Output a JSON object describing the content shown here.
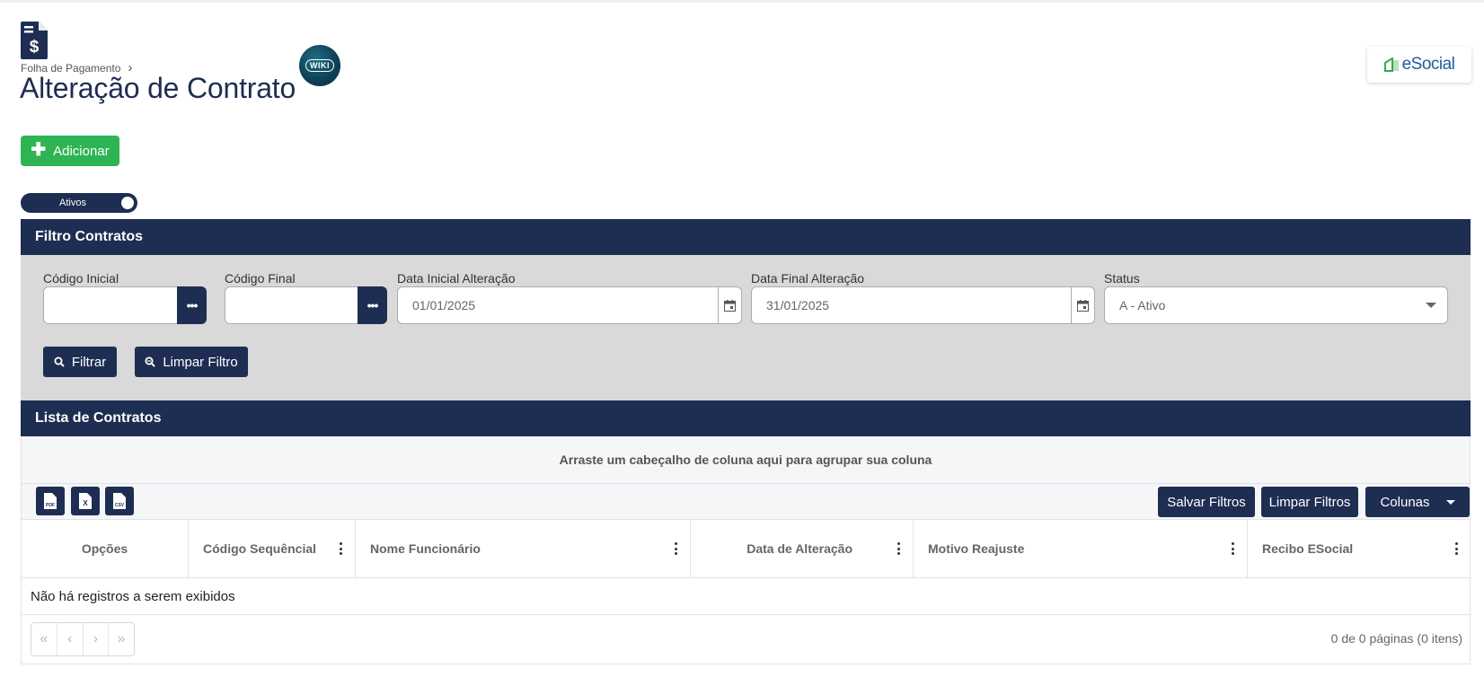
{
  "header": {
    "breadcrumb": "Folha de Pagamento",
    "breadcrumb_sep": "›",
    "title": "Alteração de Contrato",
    "wiki_label": "WIKI",
    "esocial_label": "eSocial"
  },
  "actions": {
    "add_label": "Adicionar"
  },
  "toggle": {
    "label": "Ativos",
    "on": true
  },
  "filter": {
    "title": "Filtro Contratos",
    "codigo_inicial": {
      "label": "Código Inicial",
      "value": ""
    },
    "codigo_final": {
      "label": "Código Final",
      "value": ""
    },
    "data_inicial": {
      "label": "Data Inicial Alteração",
      "value": "01/01/2025"
    },
    "data_final": {
      "label": "Data Final Alteração",
      "value": "31/01/2025"
    },
    "status": {
      "label": "Status",
      "value": "A - Ativo"
    },
    "filter_button": "Filtrar",
    "clear_button": "Limpar Filtro"
  },
  "list": {
    "title": "Lista de Contratos",
    "group_hint": "Arraste um cabeçalho de coluna aqui para agrupar sua coluna",
    "export": [
      "PDF",
      "X",
      "CSV"
    ],
    "save_filters": "Salvar Filtros",
    "clear_filters": "Limpar Filtros",
    "columns_button": "Colunas",
    "columns": [
      "Opções",
      "Código Sequêncial",
      "Nome Funcionário",
      "Data de Alteração",
      "Motivo Reajuste",
      "Recibo ESocial"
    ],
    "empty_message": "Não há registros a serem exibidos",
    "pager_info": "0 de 0 páginas (0 itens)",
    "pager_first": "«",
    "pager_prev": "‹",
    "pager_next": "›",
    "pager_last": "»"
  },
  "colors": {
    "primary": "#1e2d52",
    "success": "#2fb454",
    "filter_bg": "#d9d9d9"
  }
}
